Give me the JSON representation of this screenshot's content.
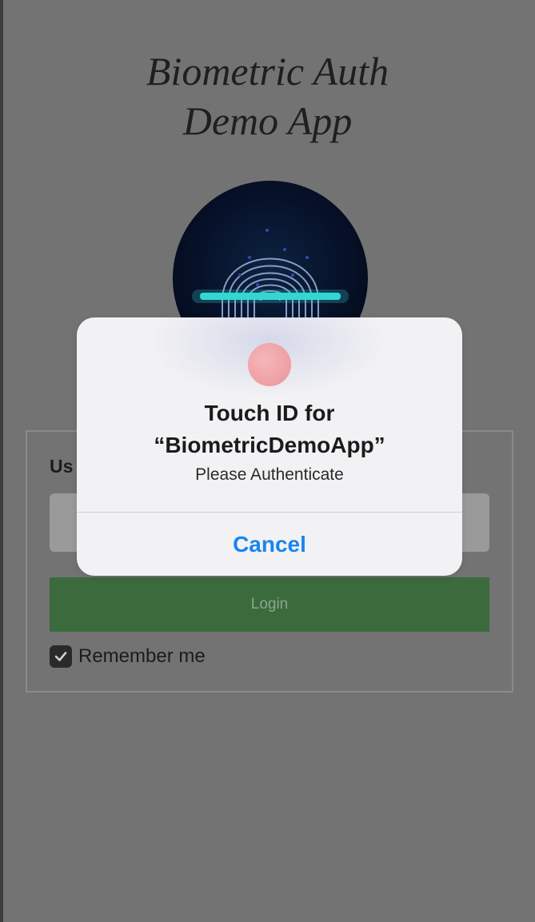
{
  "app": {
    "title_line1": "Biometric Auth",
    "title_line2": "Demo App"
  },
  "form": {
    "username_label": "Us",
    "login_label": "Login",
    "remember_label": "Remember me",
    "remember_checked": true
  },
  "dialog": {
    "icon": "fingerprint-icon",
    "title_line1": "Touch ID for",
    "title_line2": "“BiometricDemoApp”",
    "subtitle": "Please Authenticate",
    "cancel_label": "Cancel"
  },
  "colors": {
    "backdrop": "#737373",
    "login_button": "#3b6a3d",
    "cancel_text": "#1a84ee",
    "scan_line": "#35d6d2"
  }
}
